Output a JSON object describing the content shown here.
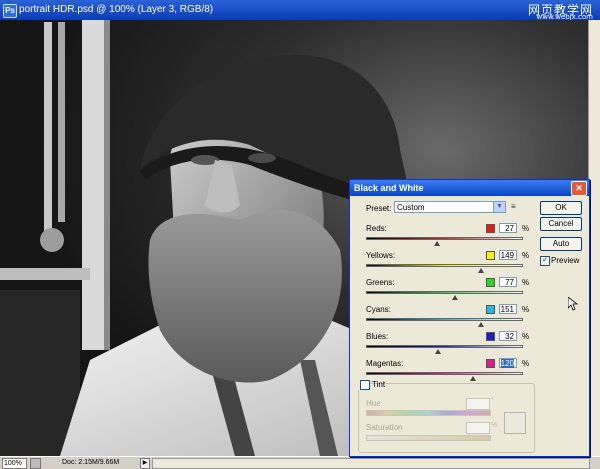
{
  "window": {
    "title": "portrait HDR.psd @ 100% (Layer 3, RGB/8)",
    "app_icon": "photoshop-doc-icon",
    "watermark_line1": "网页教学网",
    "watermark_line2": "www.webjx.com"
  },
  "status": {
    "zoom": "100%",
    "doc_info": "Doc: 2.15M/9.66M",
    "arrow": "▶"
  },
  "dialog": {
    "title": "Black and White",
    "close_glyph": "✕",
    "preset_label": "Preset:",
    "preset_value": "Custom",
    "preset_arrow": "▼",
    "preset_menu_glyph": "≡",
    "ok_label": "OK",
    "cancel_label": "Cancel",
    "auto_label": "Auto",
    "preview_label": "Preview",
    "preview_checked": true,
    "preview_mark": "✔",
    "percent": "%",
    "channels": [
      {
        "label": "Reds:",
        "value": "27",
        "color": "#e31b1b",
        "level": 0.45
      },
      {
        "label": "Yellows:",
        "value": "149",
        "color": "#f5f01a",
        "level": 0.73
      },
      {
        "label": "Greens:",
        "value": "77",
        "color": "#2fd12f",
        "level": 0.57
      },
      {
        "label": "Cyans:",
        "value": "151",
        "color": "#28b6e3",
        "level": 0.73
      },
      {
        "label": "Blues:",
        "value": "32",
        "color": "#1c1fc9",
        "level": 0.46
      },
      {
        "label": "Magentas:",
        "value": "120",
        "color": "#d91f8f",
        "level": 0.68
      }
    ],
    "tint": {
      "label": "Tint",
      "checked": false,
      "hue_label": "Hue",
      "hue_unit": "°",
      "saturation_label": "Saturation",
      "saturation_unit": "%"
    }
  }
}
